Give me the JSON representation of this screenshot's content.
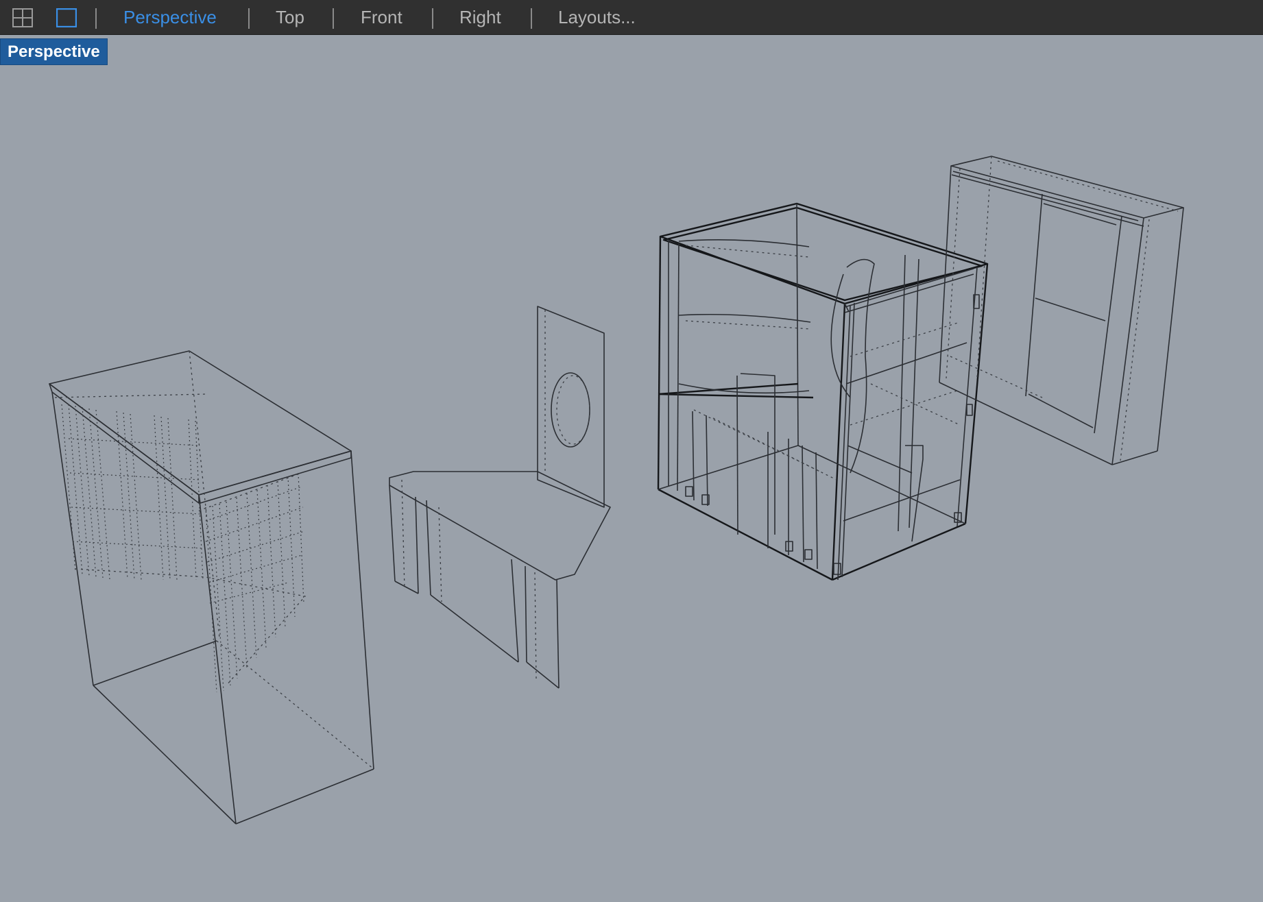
{
  "toolbar": {
    "layout_icon": "four-viewports-icon",
    "single_icon": "single-viewport-icon",
    "tabs": [
      {
        "label": "Perspective",
        "active": true
      },
      {
        "label": "Top",
        "active": false
      },
      {
        "label": "Front",
        "active": false
      },
      {
        "label": "Right",
        "active": false
      },
      {
        "label": "Layouts...",
        "active": false
      }
    ]
  },
  "viewport": {
    "label": "Perspective",
    "background": "#9aa1aa",
    "active_tab_color": "#3a8fe6",
    "label_bg": "#1f5c9c"
  }
}
